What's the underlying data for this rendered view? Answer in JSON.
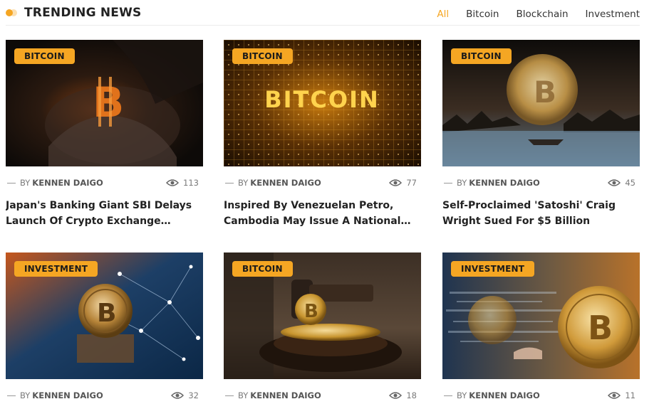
{
  "section": {
    "title": "TRENDING NEWS"
  },
  "filters": [
    {
      "label": "All",
      "active": true
    },
    {
      "label": "Bitcoin",
      "active": false
    },
    {
      "label": "Blockchain",
      "active": false
    },
    {
      "label": "Investment",
      "active": false
    }
  ],
  "articles": [
    {
      "category": "BITCOIN",
      "by": "BY",
      "author": "KENNEN DAIGO",
      "views": "113",
      "title_line1": "Japan's Banking Giant SBI Delays",
      "title_line2": "Launch Of Crypto Exchange…"
    },
    {
      "category": "BITCOIN",
      "by": "BY",
      "author": "KENNEN DAIGO",
      "views": "77",
      "title_line1": "Inspired By Venezuelan Petro,",
      "title_line2": "Cambodia May Issue A National…"
    },
    {
      "category": "BITCOIN",
      "by": "BY",
      "author": "KENNEN DAIGO",
      "views": "45",
      "title_line1": "Self-Proclaimed 'Satoshi' Craig",
      "title_line2": "Wright Sued For $5 Billion"
    },
    {
      "category": "INVESTMENT",
      "by": "BY",
      "author": "KENNEN DAIGO",
      "views": "32",
      "title_line1": "",
      "title_line2": ""
    },
    {
      "category": "BITCOIN",
      "by": "BY",
      "author": "KENNEN DAIGO",
      "views": "18",
      "title_line1": "",
      "title_line2": ""
    },
    {
      "category": "INVESTMENT",
      "by": "BY",
      "author": "KENNEN DAIGO",
      "views": "11",
      "title_line1": "",
      "title_line2": ""
    }
  ],
  "colors": {
    "accent": "#f5a623",
    "text": "#222222",
    "muted": "#7a7a7a"
  },
  "icons": {
    "title": "dot-icon",
    "views": "eye-icon"
  },
  "image_text": {
    "card2": "BITCOIN"
  }
}
